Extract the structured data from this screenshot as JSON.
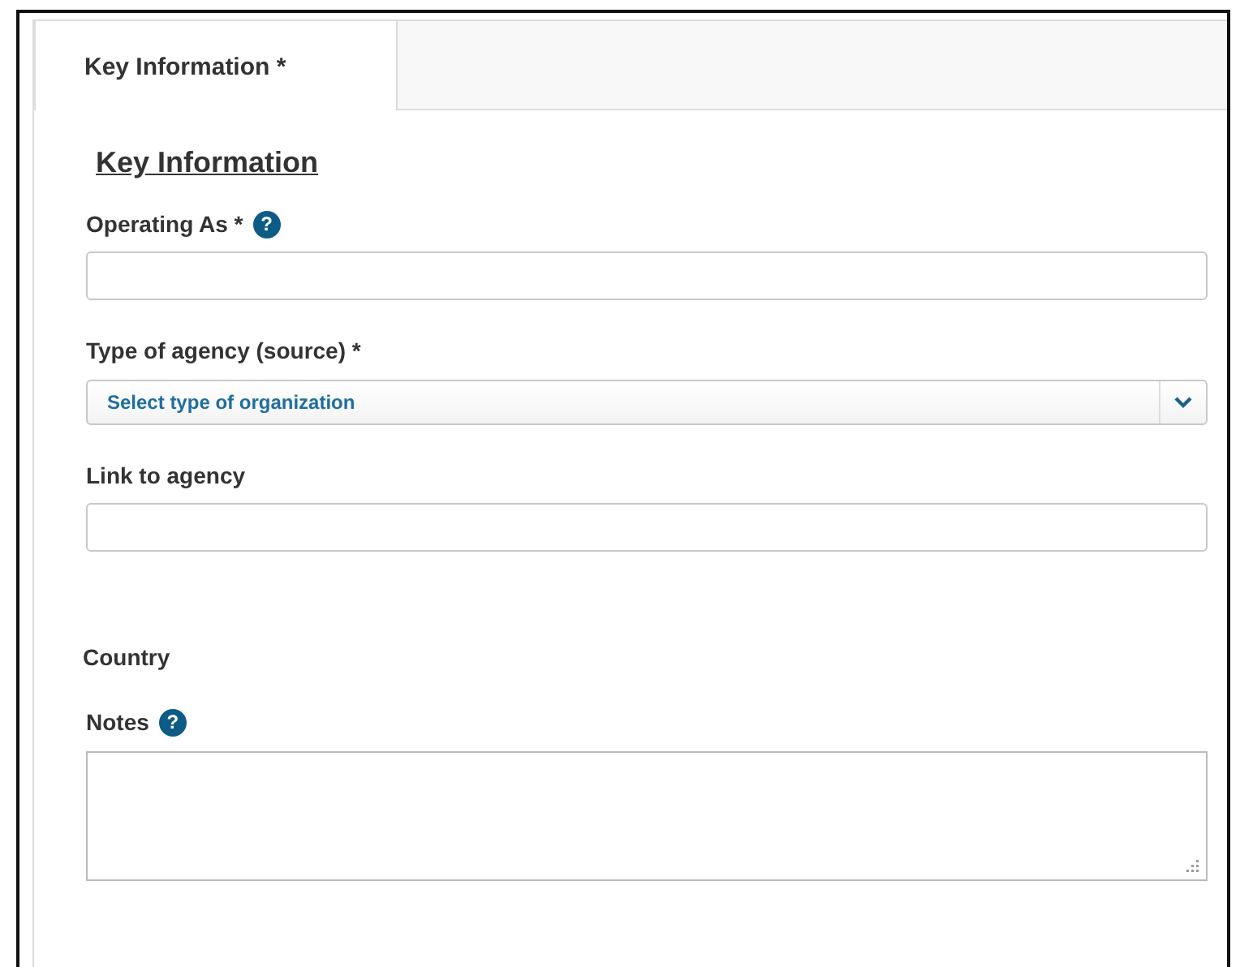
{
  "tabs": [
    {
      "label": "Key Information *",
      "selected": true
    }
  ],
  "section_title": "Key Information",
  "fields": [
    {
      "kind": "text",
      "label": "Operating As *",
      "help": "?"
    },
    {
      "kind": "select",
      "label": "Type of agency (source) *",
      "placeholder": "Select type of organization"
    },
    {
      "kind": "text",
      "label": "Link to agency"
    },
    {
      "kind": "label",
      "label": "Country"
    },
    {
      "kind": "textarea",
      "label": "Notes",
      "help": "?"
    }
  ]
}
